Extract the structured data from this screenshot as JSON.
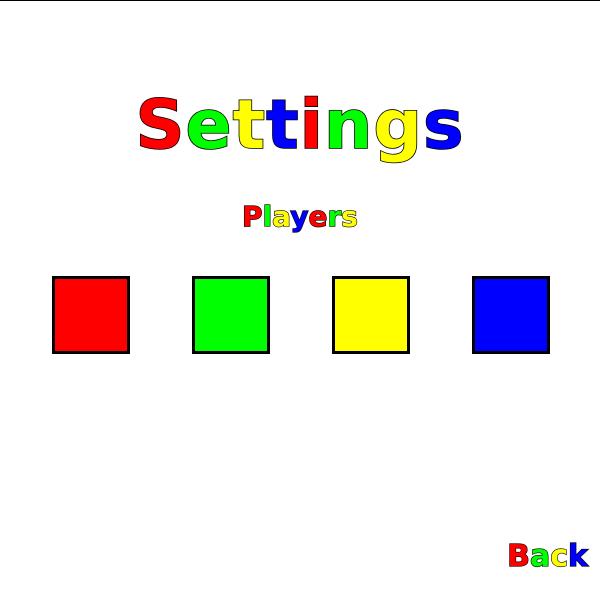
{
  "title": {
    "letters": [
      {
        "char": "S",
        "color": "#ff0000"
      },
      {
        "char": "e",
        "color": "#00ff00"
      },
      {
        "char": "t",
        "color": "#ffff00"
      },
      {
        "char": "t",
        "color": "#0000ff"
      },
      {
        "char": "i",
        "color": "#ff0000"
      },
      {
        "char": "n",
        "color": "#00ff00"
      },
      {
        "char": "g",
        "color": "#ffff00"
      },
      {
        "char": "s",
        "color": "#0000ff"
      }
    ]
  },
  "section": {
    "letters": [
      {
        "char": "P",
        "color": "#ff0000"
      },
      {
        "char": "l",
        "color": "#00ff00"
      },
      {
        "char": "a",
        "color": "#ffff00"
      },
      {
        "char": "y",
        "color": "#0000ff"
      },
      {
        "char": "e",
        "color": "#ff0000"
      },
      {
        "char": "r",
        "color": "#00ff00"
      },
      {
        "char": "s",
        "color": "#ffff00"
      }
    ]
  },
  "players": [
    {
      "color": "#ff0000"
    },
    {
      "color": "#00ff00"
    },
    {
      "color": "#ffff00"
    },
    {
      "color": "#0000ff"
    }
  ],
  "back": {
    "letters": [
      {
        "char": "B",
        "color": "#ff0000"
      },
      {
        "char": "a",
        "color": "#00ff00"
      },
      {
        "char": "c",
        "color": "#ffff00"
      },
      {
        "char": "k",
        "color": "#0000ff"
      }
    ]
  }
}
